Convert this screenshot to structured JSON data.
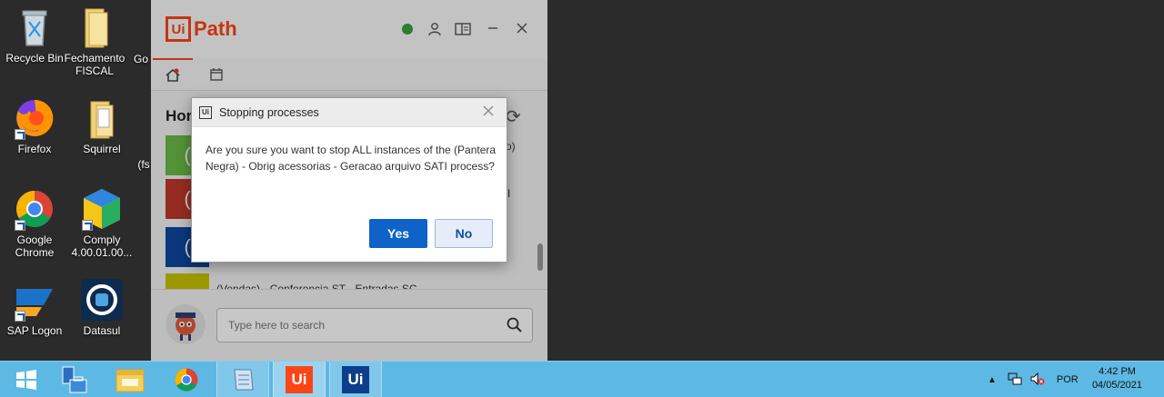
{
  "desktop": {
    "icons": [
      {
        "label": "Recycle Bin",
        "icon": "recycle-bin-icon"
      },
      {
        "label": "Fechamento FISCAL",
        "icon": "folder-icon"
      },
      {
        "label": "Go",
        "icon": "truncated-shortcut-icon"
      },
      {
        "label": "Firefox",
        "icon": "firefox-icon"
      },
      {
        "label": "Squirrel",
        "icon": "folder-icon"
      },
      {
        "label": "(fs",
        "icon": "truncated-shortcut-icon"
      },
      {
        "label": "Google Chrome",
        "icon": "chrome-icon"
      },
      {
        "label": "Comply 4.00.01.00...",
        "icon": "comply-icon"
      },
      {
        "label": "SAP Logon",
        "icon": "sap-logon-icon"
      },
      {
        "label": "Datasul",
        "icon": "datasul-icon"
      }
    ]
  },
  "uipath": {
    "logo_box": "Ui",
    "logo_text": "Path",
    "home_title": "Hor",
    "processes": [
      {
        "glyph": "(",
        "color": "#6bbb46",
        "text": "o)"
      },
      {
        "glyph": "(",
        "color": "#c0392b",
        "text": "I"
      },
      {
        "glyph": "(",
        "color": "#0d47a1",
        "text": ""
      },
      {
        "glyph": "",
        "color": "#c8c400",
        "text": "(Vendas) - Conferencia ST - Entradas SC"
      }
    ],
    "search_placeholder": "Type here to search"
  },
  "dialog": {
    "title": "Stopping processes",
    "app_icon": "Ui",
    "message": "Are you sure you want to stop ALL instances of the (Pantera Negra) - Obrig acessorias - Geracao arquivo SATI process?",
    "yes_label": "Yes",
    "no_label": "No"
  },
  "taskbar": {
    "uipath_label": "Ui",
    "uipath2_label": "Ui",
    "tray_lang": "POR",
    "time": "4:42 PM",
    "date": "04/05/2021"
  }
}
